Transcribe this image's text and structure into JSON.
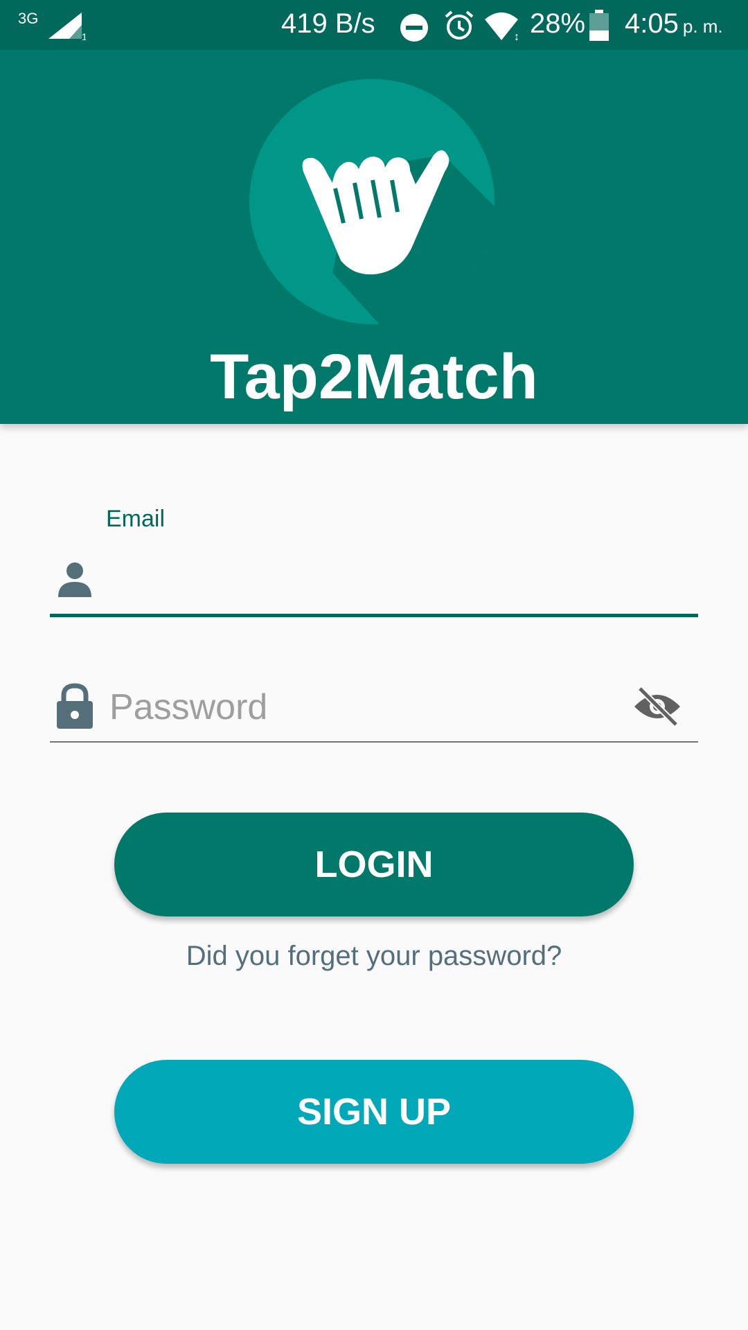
{
  "status_bar": {
    "network": "3G",
    "speed": "419 B/s",
    "battery": "28%",
    "time": "4:05",
    "ampm": "p. m."
  },
  "header": {
    "app_name": "Tap2Match",
    "bg_color": "#00796b"
  },
  "form": {
    "email_label": "Email",
    "email_value": "",
    "password_placeholder": "Password",
    "password_value": ""
  },
  "buttons": {
    "login_label": "LOGIN",
    "forgot_label": "Did you forget your password?",
    "signup_label": "SIGN UP"
  },
  "icons": [
    "signal-icon",
    "dnd-icon",
    "alarm-icon",
    "wifi-icon",
    "battery-icon",
    "shaka-hand-icon",
    "person-icon",
    "lock-icon",
    "visibility-off-icon"
  ],
  "colors": {
    "primary": "#00796b",
    "status_bar": "#00695c",
    "signup": "#00a8b8"
  }
}
